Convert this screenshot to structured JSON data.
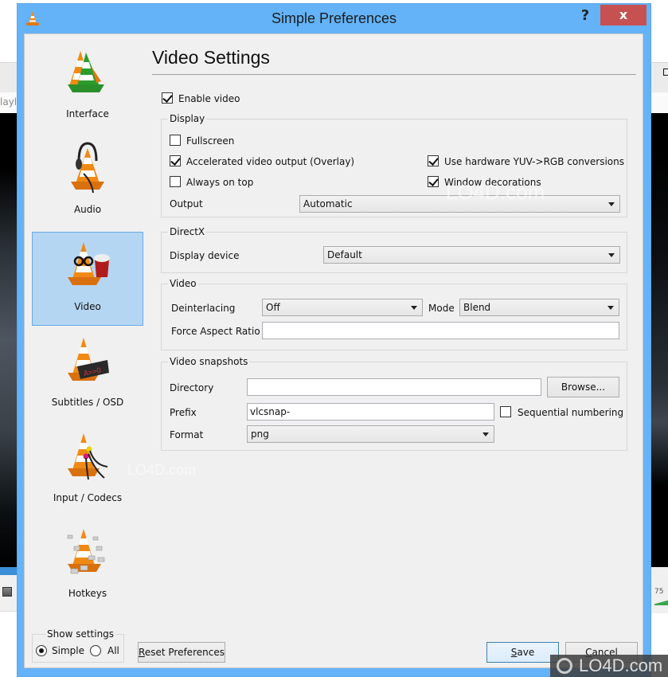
{
  "background": {
    "left_tab_text": "layl",
    "volume_text": "75"
  },
  "window": {
    "title": "Simple Preferences",
    "help_label": "?",
    "close_label": "x"
  },
  "sidebar": {
    "items": [
      {
        "label": "Interface",
        "icon": "interface-cone-icon",
        "selected": false
      },
      {
        "label": "Audio",
        "icon": "audio-headphones-cone-icon",
        "selected": false
      },
      {
        "label": "Video",
        "icon": "video-glasses-popcorn-cone-icon",
        "selected": true
      },
      {
        "label": "Subtitles / OSD",
        "icon": "subtitles-display-cone-icon",
        "selected": false
      },
      {
        "label": "Input / Codecs",
        "icon": "input-cables-cone-icon",
        "selected": false
      },
      {
        "label": "Hotkeys",
        "icon": "hotkeys-keys-cone-icon",
        "selected": false
      }
    ],
    "show_settings": {
      "title": "Show settings",
      "options": [
        {
          "label": "Simple",
          "checked": true
        },
        {
          "label": "All",
          "checked": false
        }
      ]
    }
  },
  "main": {
    "title": "Video Settings",
    "enable_video": {
      "label": "Enable video",
      "checked": true
    },
    "display": {
      "title": "Display",
      "fullscreen": {
        "label": "Fullscreen",
        "checked": false
      },
      "accelerated": {
        "label": "Accelerated video output (Overlay)",
        "checked": true
      },
      "always_on_top": {
        "label": "Always on top",
        "checked": false
      },
      "hw_yuv": {
        "label": "Use hardware YUV->RGB conversions",
        "checked": true
      },
      "window_decorations": {
        "label": "Window decorations",
        "checked": true
      },
      "output_label": "Output",
      "output_value": "Automatic"
    },
    "directx": {
      "title": "DirectX",
      "device_label": "Display device",
      "device_value": "Default"
    },
    "video": {
      "title": "Video",
      "deinterlacing_label": "Deinterlacing",
      "deinterlacing_value": "Off",
      "mode_label": "Mode",
      "mode_value": "Blend",
      "aspect_label": "Force Aspect Ratio",
      "aspect_value": ""
    },
    "snapshots": {
      "title": "Video snapshots",
      "directory_label": "Directory",
      "directory_value": "",
      "browse_label": "Browse...",
      "prefix_label": "Prefix",
      "prefix_value": "vlcsnap-",
      "sequential": {
        "label": "Sequential numbering",
        "checked": false
      },
      "format_label": "Format",
      "format_value": "png"
    }
  },
  "footer": {
    "reset_label_u": "R",
    "reset_label_rest": "eset Preferences",
    "save_label_u": "S",
    "save_label_rest": "ave",
    "cancel_label_u": "C",
    "cancel_label_rest": "ancel"
  },
  "watermark": {
    "text": "LO4D.com"
  }
}
